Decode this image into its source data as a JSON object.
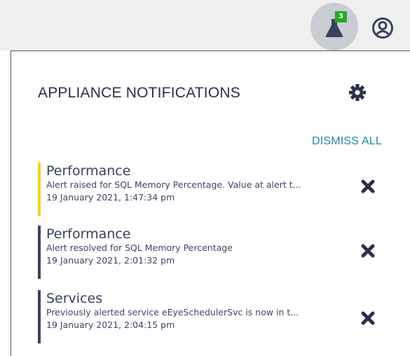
{
  "header": {
    "notification_count": "3",
    "icons": {
      "notifications": "notification-beaker-icon",
      "user": "user-circle-icon"
    }
  },
  "panel": {
    "title": "APPLIANCE NOTIFICATIONS",
    "settings_icon": "gear-icon",
    "dismiss_all_label": "DISMISS ALL",
    "notifications": [
      {
        "category": "Performance",
        "message": "Alert raised for SQL Memory Percentage. Value at alert t...",
        "timestamp": "19 January 2021, 1:47:34 pm",
        "severity_color": "#f2d21c"
      },
      {
        "category": "Performance",
        "message": "Alert resolved for SQL Memory Percentage",
        "timestamp": "19 January 2021, 2:01:32 pm",
        "severity_color": "#3a415e"
      },
      {
        "category": "Services",
        "message": "Previously alerted service eEyeSchedulerSvc is now in t...",
        "timestamp": "19 January 2021, 2:04:15 pm",
        "severity_color": "#3a415e"
      }
    ]
  }
}
